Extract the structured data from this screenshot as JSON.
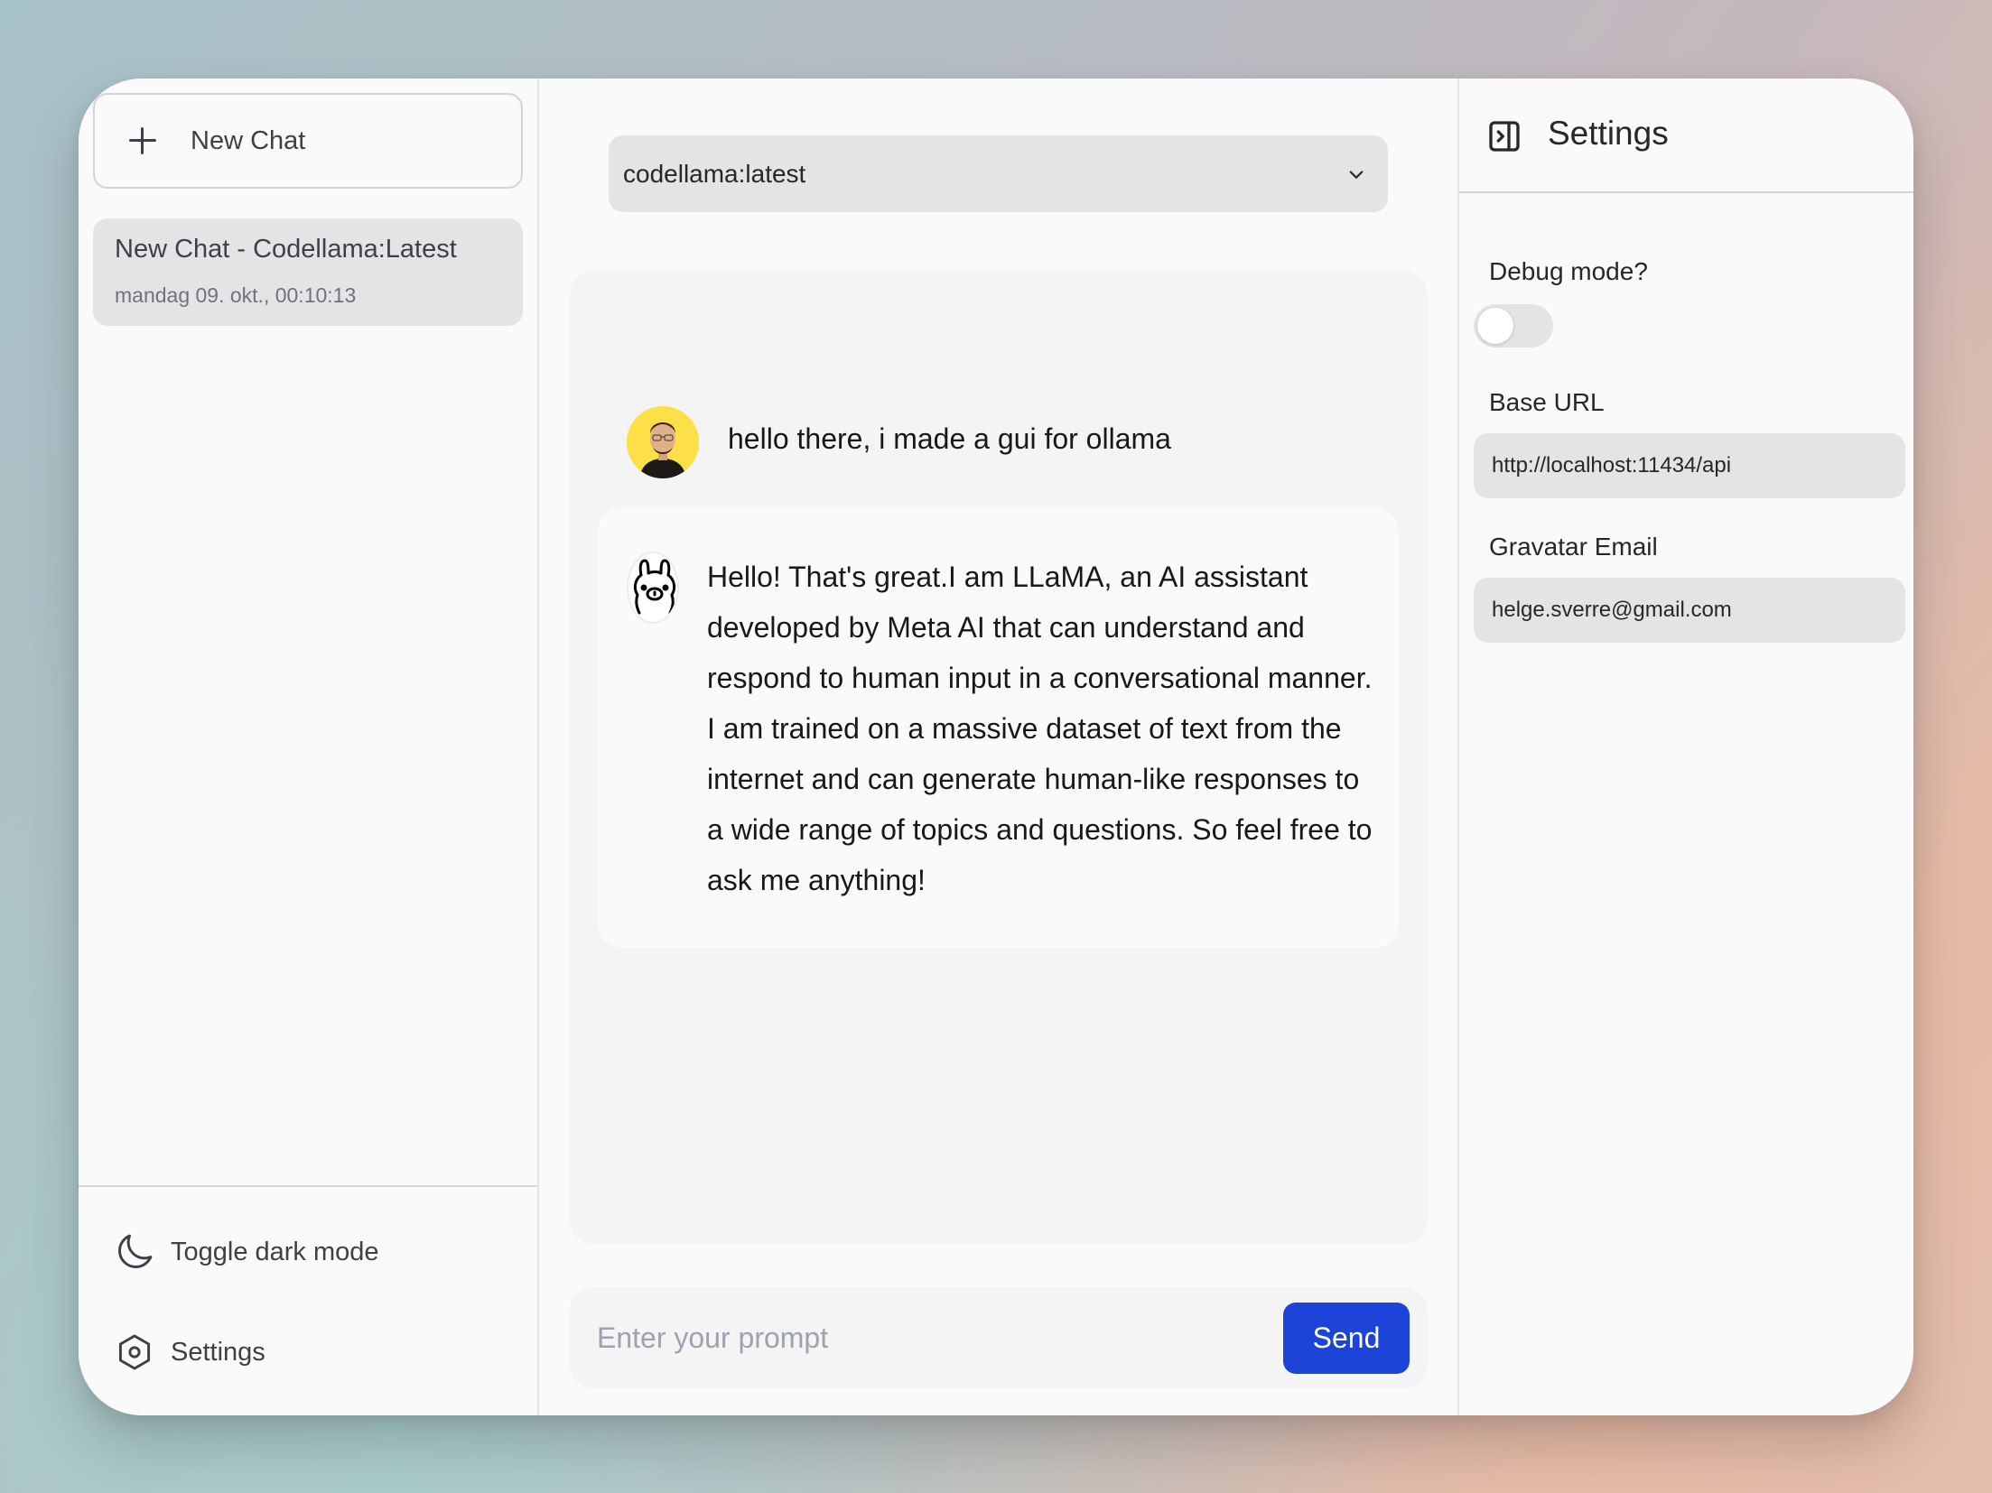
{
  "sidebar": {
    "new_chat_label": "New Chat",
    "chats": [
      {
        "title": "New Chat - Codellama:Latest",
        "date": "mandag 09. okt., 00:10:13",
        "active": true
      }
    ],
    "toggle_dark_mode_label": "Toggle dark mode",
    "settings_label": "Settings"
  },
  "main": {
    "model_select": {
      "selected": "codellama:latest"
    },
    "messages": [
      {
        "role": "user",
        "text": "hello there, i made a gui for ollama"
      },
      {
        "role": "assistant",
        "text": "Hello! That's great.I am LLaMA, an AI assistant developed by Meta AI that can understand and respond to human input in a conversational manner. I am trained on a massive dataset of text from the internet and can generate human-like responses to a wide range of topics and questions. So feel free to ask me anything!"
      }
    ],
    "prompt": {
      "placeholder": "Enter your prompt",
      "value": ""
    },
    "send_label": "Send",
    "colors": {
      "send_button": "#1d44d8",
      "user_avatar_bg": "#fde047"
    }
  },
  "settings": {
    "title": "Settings",
    "debug_mode": {
      "label": "Debug mode?",
      "enabled": false
    },
    "base_url": {
      "label": "Base URL",
      "value": "http://localhost:11434/api"
    },
    "gravatar_email": {
      "label": "Gravatar Email",
      "value": "helge.sverre@gmail.com"
    }
  }
}
